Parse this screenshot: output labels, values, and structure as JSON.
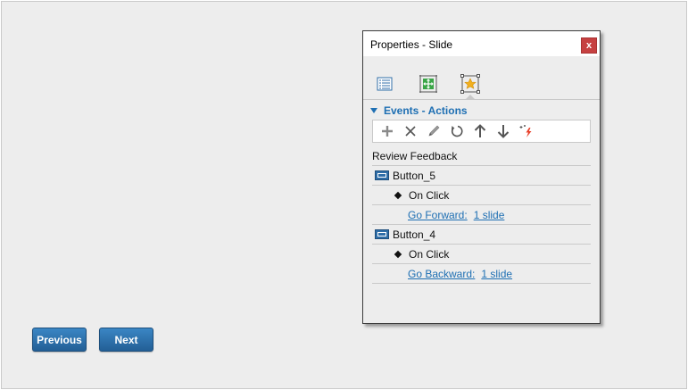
{
  "navigation": {
    "previous_label": "Previous",
    "next_label": "Next"
  },
  "panel": {
    "title": "Properties - Slide",
    "close_label": "x",
    "tabs": [
      {
        "icon": "list-properties-icon"
      },
      {
        "icon": "slide-size-icon"
      },
      {
        "icon": "events-star-icon",
        "active": true
      }
    ],
    "section_title": "Events - Actions",
    "toolbar": [
      "add-icon",
      "delete-icon",
      "edit-icon",
      "refresh-icon",
      "move-up-icon",
      "move-down-icon",
      "trigger-icon"
    ],
    "slide_name": "Review Feedback",
    "objects": [
      {
        "name": "Button_5",
        "event": "On Click",
        "action": "Go Forward:",
        "target": "1 slide"
      },
      {
        "name": "Button_4",
        "event": "On Click",
        "action": "Go Backward:",
        "target": "1 slide"
      }
    ]
  }
}
